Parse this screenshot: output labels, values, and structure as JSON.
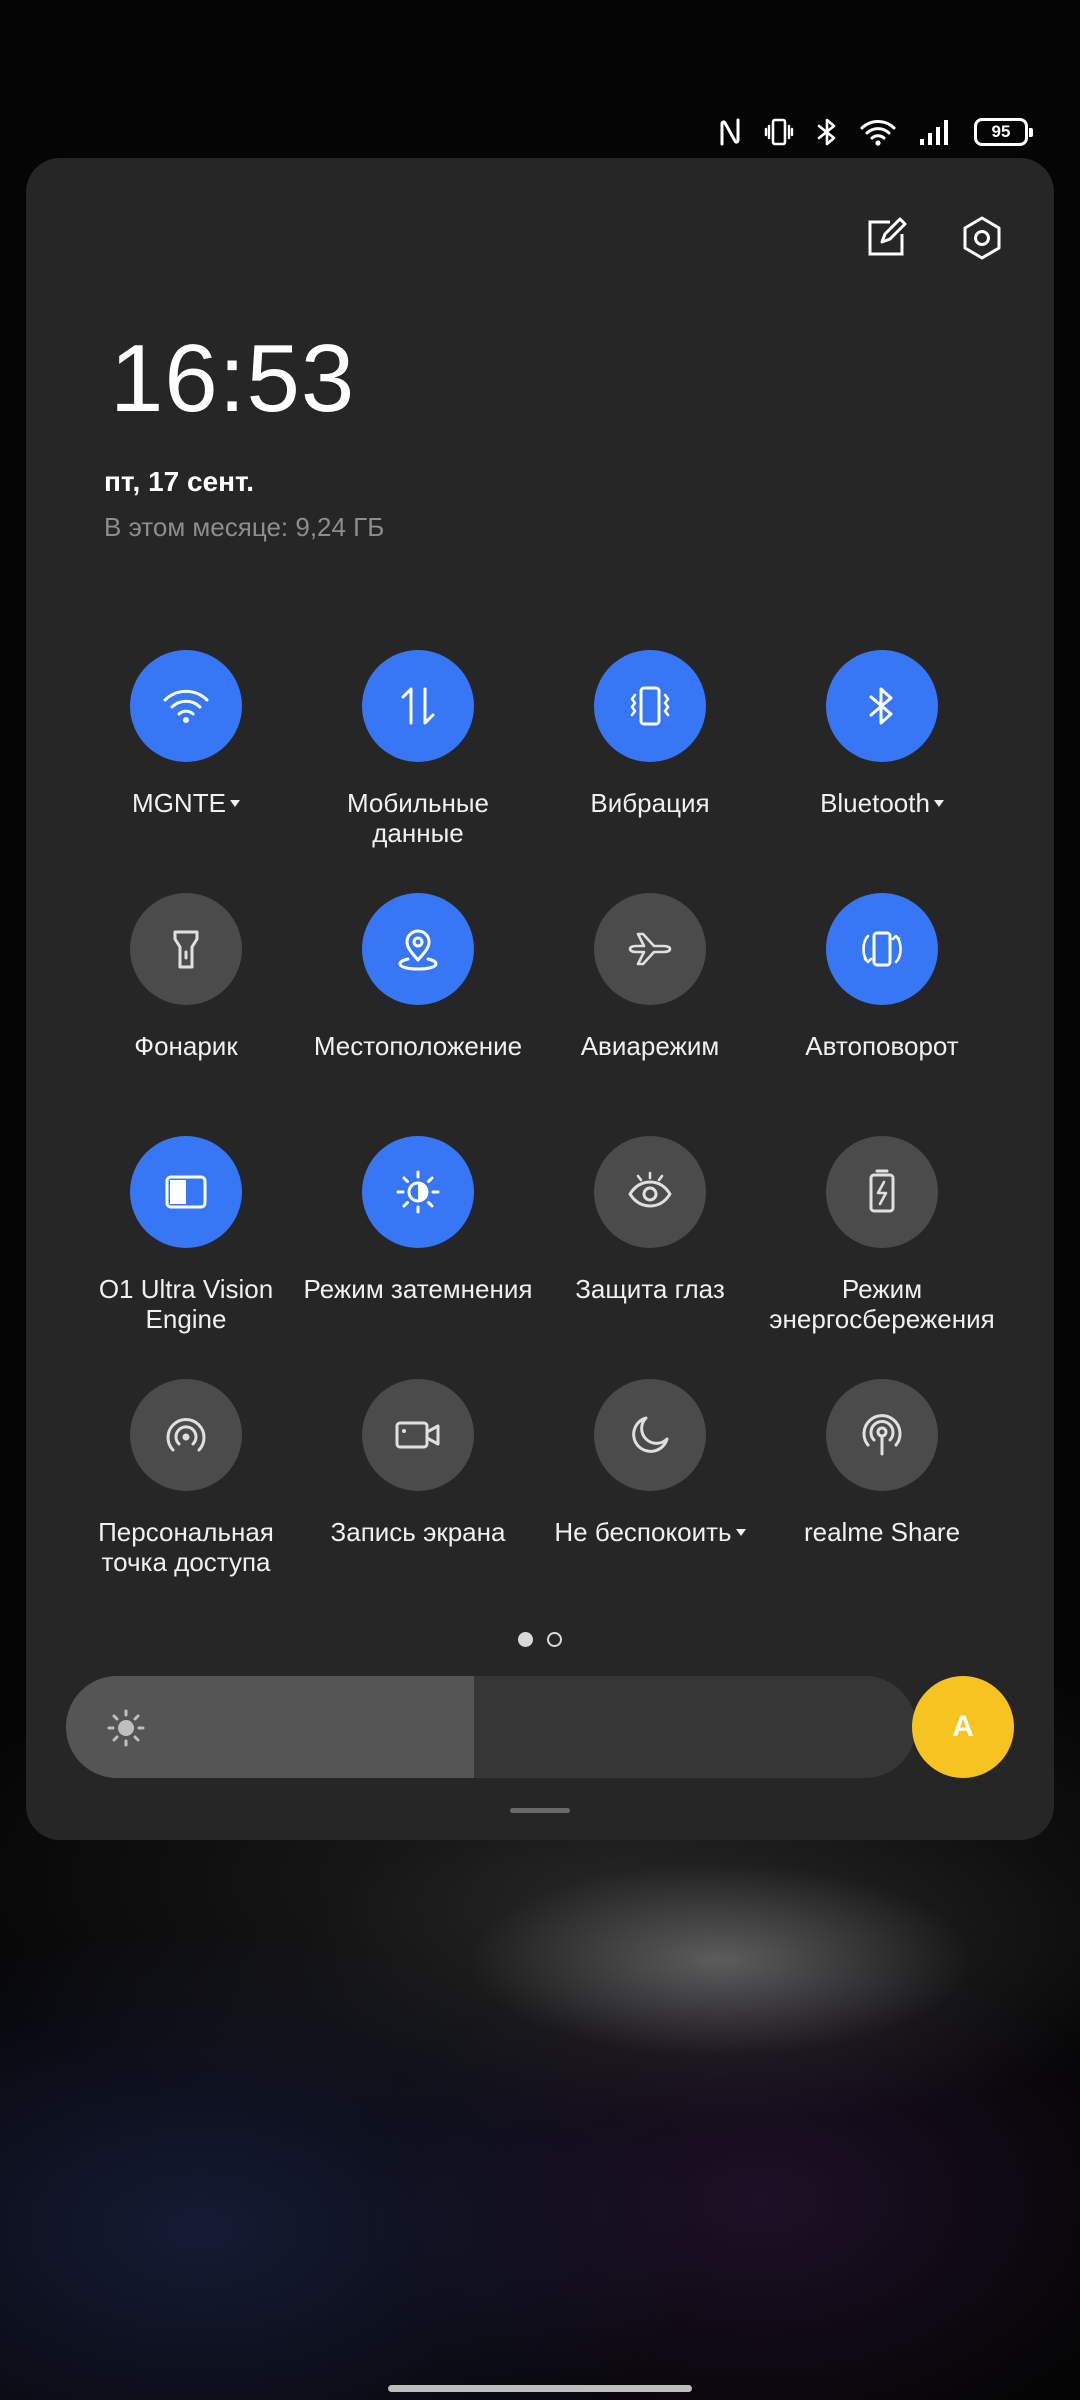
{
  "status_bar": {
    "icons": [
      "nfc-icon",
      "vibrate-icon",
      "bluetooth-icon",
      "wifi-icon",
      "signal-icon"
    ],
    "battery_level": "95"
  },
  "panel": {
    "clock": "16:53",
    "date": "пт, 17 сент.",
    "data_usage": "В этом месяце: 9,24 ГБ",
    "actions": [
      "edit-icon",
      "settings-icon"
    ]
  },
  "tiles": [
    {
      "label": "MGNTE",
      "icon": "wifi-icon",
      "active": true,
      "dropdown": true
    },
    {
      "label": "Мобильные данные",
      "icon": "mobile-data-icon",
      "active": true,
      "dropdown": false
    },
    {
      "label": "Вибрация",
      "icon": "vibration-icon",
      "active": true,
      "dropdown": false
    },
    {
      "label": "Bluetooth",
      "icon": "bluetooth-icon",
      "active": true,
      "dropdown": true
    },
    {
      "label": "Фонарик",
      "icon": "flashlight-icon",
      "active": false,
      "dropdown": false
    },
    {
      "label": "Местоположение",
      "icon": "location-icon",
      "active": true,
      "dropdown": false
    },
    {
      "label": "Авиарежим",
      "icon": "airplane-icon",
      "active": false,
      "dropdown": false
    },
    {
      "label": "Автоповорот",
      "icon": "autorotate-icon",
      "active": true,
      "dropdown": false
    },
    {
      "label": "O1 Ultra Vision Engine",
      "icon": "vision-engine-icon",
      "active": true,
      "dropdown": false
    },
    {
      "label": "Режим затемнения",
      "icon": "dark-mode-icon",
      "active": true,
      "dropdown": false
    },
    {
      "label": "Защита глаз",
      "icon": "eye-icon",
      "active": false,
      "dropdown": false
    },
    {
      "label": "Режим энергосбережения",
      "icon": "battery-saver-icon",
      "active": false,
      "dropdown": false
    },
    {
      "label": "Персональная точка доступа",
      "icon": "hotspot-icon",
      "active": false,
      "dropdown": false
    },
    {
      "label": "Запись экрана",
      "icon": "screen-record-icon",
      "active": false,
      "dropdown": false
    },
    {
      "label": "Не беспокоить",
      "icon": "moon-icon",
      "active": false,
      "dropdown": true
    },
    {
      "label": "realme Share",
      "icon": "share-icon",
      "active": false,
      "dropdown": false
    }
  ],
  "pagination": {
    "current": 1,
    "total": 2
  },
  "brightness": {
    "level": 0.48,
    "icon": "sun-icon"
  },
  "auto_brightness": {
    "label": "A"
  },
  "colors": {
    "active": "#3777f5",
    "inactive": "#4b4b4c",
    "panel": "#262627",
    "auto_button": "#f7c321"
  }
}
